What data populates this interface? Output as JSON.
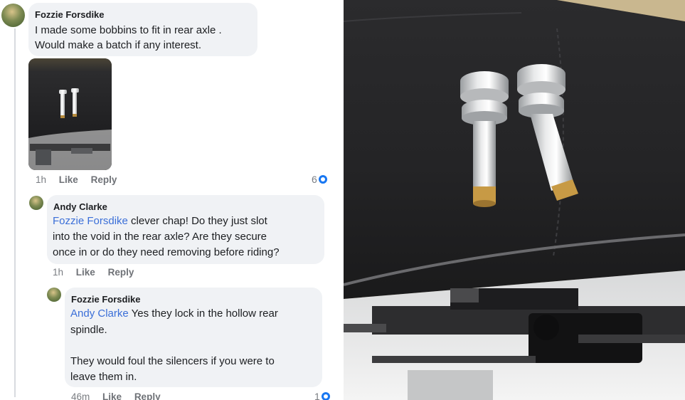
{
  "comments": [
    {
      "author": "Fozzie Forsdike",
      "lines": [
        "I made some bobbins to fit in rear axle .",
        "Would make a batch if any interest."
      ],
      "time": "1h",
      "like": "Like",
      "reply": "Reply",
      "reaction_count": "6"
    },
    {
      "author": "Andy Clarke",
      "mention": "Fozzie Forsdike",
      "lines": [
        " clever chap! Do they just slot",
        "into the void in the rear axle? Are they secure",
        "once in or do they need removing before riding?"
      ],
      "time": "1h",
      "like": "Like",
      "reply": "Reply"
    },
    {
      "author": "Fozzie Forsdike",
      "mention": "Andy Clarke",
      "lines": [
        " Yes they lock in the hollow rear",
        "spindle.",
        "They would foul the silencers if you were to",
        "leave them in."
      ],
      "time": "46m",
      "like": "Like",
      "reply": "Reply",
      "reaction_count": "1"
    }
  ],
  "colors": {
    "mention": "#3b6fd8",
    "bubble": "#f0f2f5",
    "reaction": "#1877f2"
  },
  "icons": [
    "avatar",
    "reaction-icon"
  ]
}
